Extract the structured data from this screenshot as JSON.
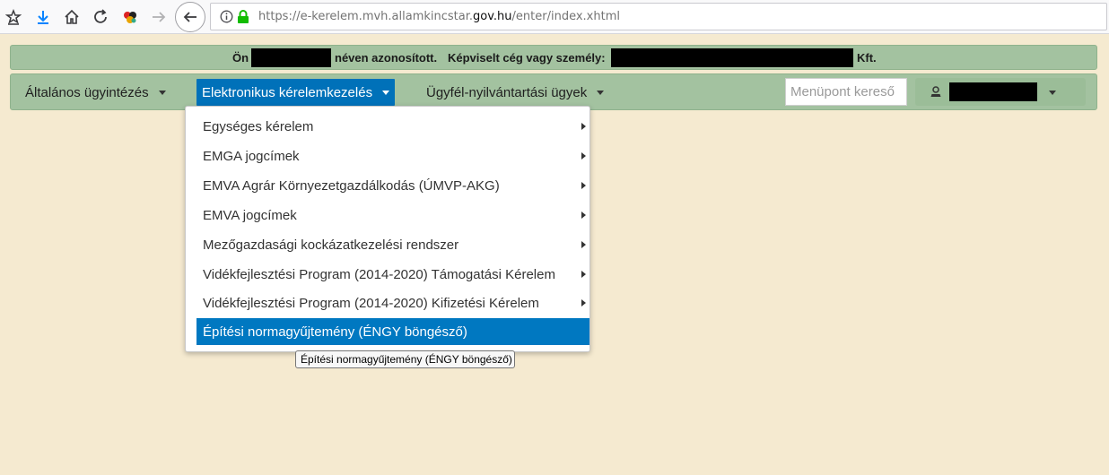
{
  "browser": {
    "url_prefix": "https://e-kerelem.mvh.allamkincstar.",
    "url_domain": "gov.hu",
    "url_suffix": "/enter/index.xhtml",
    "icons": [
      "star-list-icon",
      "download-icon",
      "home-icon",
      "reload-icon",
      "extension-icon",
      "forward-icon",
      "back-icon",
      "info-icon",
      "lock-icon"
    ]
  },
  "idbar": {
    "prefix": "Ön",
    "identified": "néven azonosított.",
    "represented_label": "Képviselt cég vagy személy:",
    "company_suffix": "Kft."
  },
  "menu": {
    "items": [
      {
        "label": "Általános ügyintézés"
      },
      {
        "label": "Elektronikus kérelemkezelés"
      },
      {
        "label": "Ügyfél-nyilvántartási ügyek"
      }
    ],
    "search_placeholder": "Menüpont kereső"
  },
  "dropdown": {
    "items": [
      {
        "label": "Egységes kérelem"
      },
      {
        "label": "EMGA jogcímek"
      },
      {
        "label": "EMVA Agrár Környezetgazdálkodás (ÚMVP-AKG)"
      },
      {
        "label": "EMVA jogcímek"
      },
      {
        "label": "Mezőgazdasági kockázatkezelési rendszer"
      },
      {
        "label": "Vidékfejlesztési Program (2014-2020) Támogatási Kérelem"
      },
      {
        "label": "Vidékfejlesztési Program (2014-2020) Kifizetési Kérelem"
      },
      {
        "label": "Építési normagyűjtemény (ÉNGY böngésző)"
      }
    ]
  },
  "tooltip": "Építési normagyűjtemény (ÉNGY böngésző)",
  "colors": {
    "page_background": "#f5ead0",
    "bar_green": "#a3c2a0",
    "active_blue": "#0071b9",
    "highlight_blue": "#0078c1"
  }
}
